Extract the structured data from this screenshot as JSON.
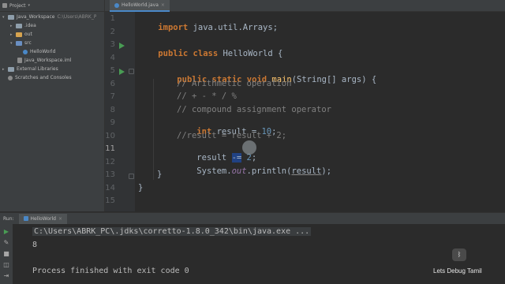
{
  "project_panel": {
    "title": "Project",
    "tree": [
      {
        "label": "Java_Workspace",
        "extra": "C:\\Users\\ABRK_P"
      },
      {
        "label": ".idea"
      },
      {
        "label": "out"
      },
      {
        "label": "src"
      },
      {
        "label": "HelloWorld"
      },
      {
        "label": "Java_Workspace.iml"
      },
      {
        "label": "External Libraries"
      },
      {
        "label": "Scratches and Consoles"
      }
    ]
  },
  "editor": {
    "tab_label": "HelloWorld.java",
    "line_numbers": [
      "1",
      "2",
      "3",
      "4",
      "5",
      "6",
      "7",
      "8",
      "9",
      "10",
      "11",
      "12",
      "13",
      "14",
      "15"
    ],
    "code": {
      "l1_kw": "import",
      "l1_rest": " java.util.Arrays;",
      "l3_kw": "public class",
      "l3_rest": " HelloWorld {",
      "l5_kw1": "public static void",
      "l5_fn": "main",
      "l5_rest": "(String[] args) {",
      "l6": "// Arithmetic operation",
      "l7": "// + - * / %",
      "l8": "// compound assignment operator",
      "l9_kw": "int",
      "l9_rest": " result = ",
      "l9_num": "10",
      "l9_end": ";",
      "l10": "//result = result + 2;",
      "l11_a": "result ",
      "l11_sel": "-=",
      "l11_b": " ",
      "l11_num": "2",
      "l11_end": ";",
      "l12_a": "System.",
      "l12_field": "out",
      "l12_b": ".println(",
      "l12_und": "result",
      "l12_c": ");",
      "l13": "}",
      "l14": "}"
    }
  },
  "run_panel": {
    "label": "Run:",
    "tab_label": "HelloWorld",
    "console": {
      "command": "C:\\Users\\ABRK_PC\\.jdks\\corretto-1.8.0_342\\bin\\java.exe ...",
      "output": "8",
      "exit_message": "Process finished with exit code 0"
    }
  },
  "watermark": {
    "text": "Lets Debug Tamil",
    "icon_glyph": "ᛒ"
  },
  "colors": {
    "keyword": "#cc7832",
    "comment": "#808080",
    "number": "#6897bb",
    "accent": "#4a88c7"
  }
}
